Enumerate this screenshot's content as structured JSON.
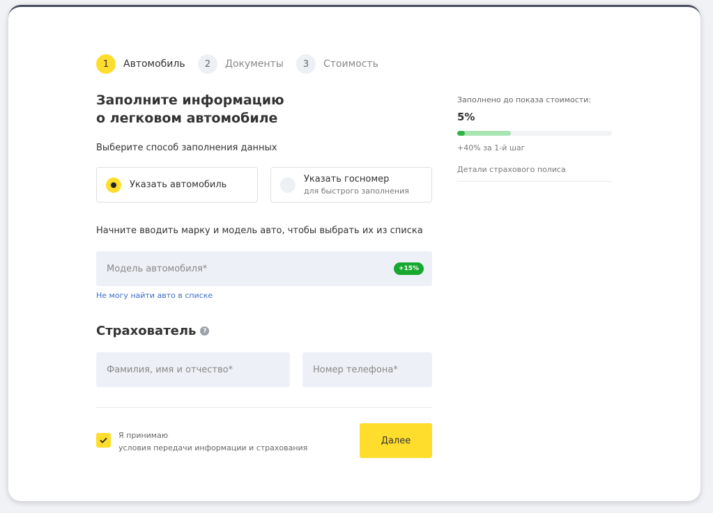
{
  "steps": [
    {
      "num": "1",
      "label": "Автомобиль"
    },
    {
      "num": "2",
      "label": "Документы"
    },
    {
      "num": "3",
      "label": "Стоимость"
    }
  ],
  "form": {
    "title_line1": "Заполните информацию",
    "title_line2": "о легковом автомобиле",
    "method_label": "Выберите способ заполнения данных",
    "options": [
      {
        "label": "Указать автомобиль",
        "selected": true
      },
      {
        "label": "Указать госномер",
        "sub": "для быстрого заполнения",
        "selected": false
      }
    ],
    "hint": "Начните вводить марку и модель авто, чтобы выбрать их из списка",
    "model_placeholder": "Модель автомобиля*",
    "model_badge": "+15%",
    "not_found_link": "Не могу найти авто в списке"
  },
  "insurer": {
    "title": "Страхователь",
    "help_icon": "?",
    "name_placeholder": "Фамилия, имя и отчество*",
    "phone_placeholder": "Номер телефона*"
  },
  "consent": {
    "line1": "Я принимаю",
    "line2": "условия передачи информации и страхования",
    "checked": true
  },
  "next_button": "Далее",
  "progress": {
    "label": "Заполнено до показа стоимости:",
    "value": "5%",
    "fill_percent": 5,
    "step_bonus_percent": 40,
    "step_bonus_text": "+40% за 1-й шаг",
    "details": "Детали страхового полиса"
  },
  "colors": {
    "accent": "#ffdd2d",
    "success": "#16a72f",
    "link": "#3b6fc4",
    "input_bg": "#edf1f7"
  }
}
